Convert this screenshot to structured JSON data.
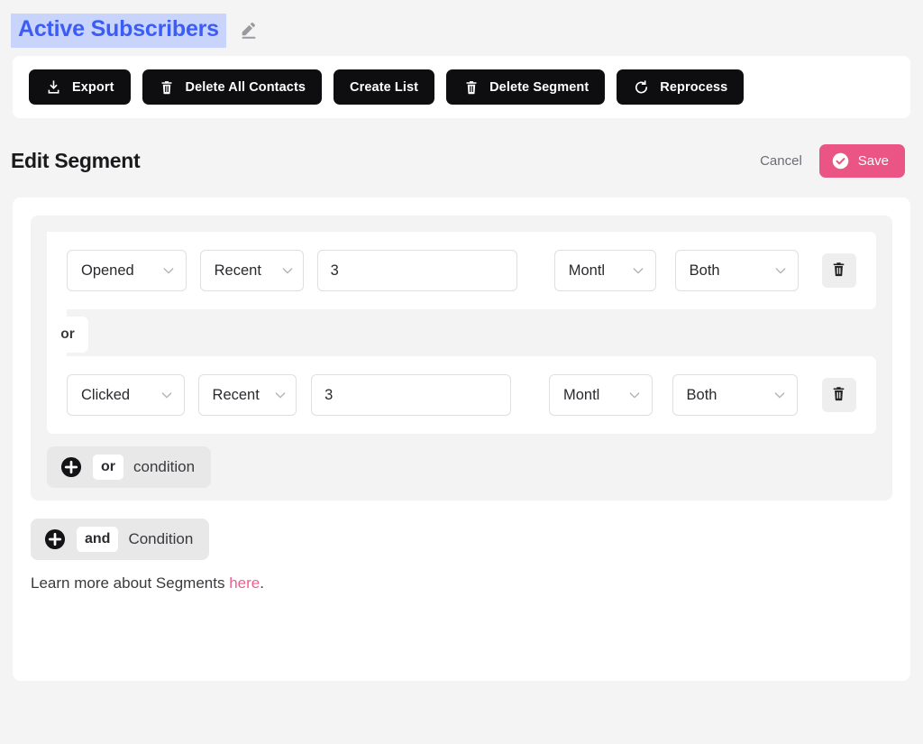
{
  "colors": {
    "page_bg": "#f4f4f5",
    "accent_pink": "#ea5586",
    "title_blue": "#3b5cf5",
    "title_selection_bg": "#c9d4fd",
    "link_pink": "#ef5f8e",
    "button_black": "#0e0e10"
  },
  "header": {
    "segment_name": "Active Subscribers",
    "edit_icon": "pencil-icon"
  },
  "toolbar": {
    "buttons": [
      {
        "label": "Export",
        "icon": "download-icon"
      },
      {
        "label": "Delete All Contacts",
        "icon": "trash-icon"
      },
      {
        "label": "Create List",
        "icon": "none"
      },
      {
        "label": "Delete Segment",
        "icon": "trash-icon"
      },
      {
        "label": "Reprocess",
        "icon": "refresh-icon"
      }
    ]
  },
  "edit_section": {
    "title": "Edit Segment",
    "cancel_label": "Cancel",
    "save_label": "Save",
    "save_icon": "check-circle-icon"
  },
  "builder": {
    "group_operator": "or",
    "conditions": [
      {
        "attribute": "Opened",
        "recency": "Recent",
        "amount": "3",
        "amount_placeholder": "",
        "unit": "Montl",
        "scope": "Both",
        "delete_icon": "trash-icon"
      },
      {
        "attribute": "Clicked",
        "recency": "Recent",
        "amount": "3",
        "amount_placeholder": "",
        "unit": "Montl",
        "scope": "Both",
        "delete_icon": "trash-icon"
      }
    ],
    "add_or": {
      "keyword": "or",
      "text": "condition",
      "icon": "plus-circle-icon"
    },
    "add_and": {
      "keyword": "and",
      "text": "Condition",
      "icon": "plus-circle-icon"
    },
    "footer": {
      "text_before": "Learn more about Segments ",
      "link_label": "here",
      "text_after": "."
    }
  }
}
